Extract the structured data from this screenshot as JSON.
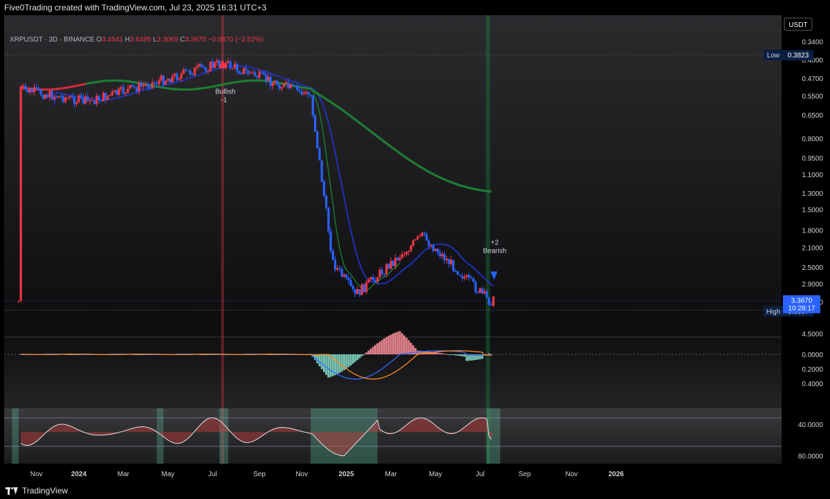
{
  "header": {
    "caption": "Five0Trading created with TradingView.com, Jul 23, 2025 16:31 UTC+3"
  },
  "legend": {
    "symbol": "XRPUSDT · 3D · BINANCE",
    "o_label": "O",
    "o": "3.4541",
    "h_label": "H",
    "h": "3.6495",
    "l_label": "L",
    "l": "3.3069",
    "c_label": "C",
    "c": "3.3670",
    "change": "−0.0870 (−2.52%)"
  },
  "footer": {
    "brand": "TradingView"
  },
  "colors": {
    "up": "#f23645",
    "down": "#2962ff",
    "green_ma": "#1e7d32",
    "blue_ma": "#1f32c8",
    "price_tag": "#2962ff"
  },
  "chart_data": [
    {
      "type": "candlestick",
      "pane": "price",
      "scale": "inverted-log",
      "currency_label": "USDT",
      "y_ticks": [
        "0.3400",
        "0.4000",
        "0.4700",
        "0.5500",
        "0.6500",
        "0.8000",
        "0.9500",
        "1.1000",
        "1.3000",
        "1.5000",
        "1.8000",
        "2.1000",
        "2.5000",
        "2.9000",
        "3.4000",
        "4.5000"
      ],
      "x_ticks": [
        "Nov",
        "2024",
        "Mar",
        "May",
        "Jul",
        "Sep",
        "Nov",
        "2025",
        "Mar",
        "May",
        "Jul",
        "Sep",
        "Nov",
        "2026"
      ],
      "tags": {
        "low_label": "Low",
        "low_value": "0.3823",
        "high_label": "High",
        "high_value": "3.6607",
        "last_value": "3.3670",
        "countdown": "10:28:17"
      },
      "annotations": [
        {
          "text": "Bullish",
          "sub": "-1",
          "date": "Jul 2024"
        },
        {
          "text": "+2",
          "sub": "Bearish",
          "date": "Jul 2025"
        }
      ],
      "key_points": [
        {
          "date": "Oct 2023",
          "price": 0.52
        },
        {
          "date": "Jan 2024",
          "price": 0.58
        },
        {
          "date": "Jul 2024",
          "price": 0.41
        },
        {
          "date": "Nov 2024",
          "price": 0.55
        },
        {
          "date": "Dec 2024",
          "price": 2.4
        },
        {
          "date": "Jan 2025",
          "price": 3.2
        },
        {
          "date": "Apr 2025",
          "price": 1.9
        },
        {
          "date": "Jul 2025",
          "price": 3.37
        }
      ]
    },
    {
      "type": "histogram+line",
      "pane": "macd",
      "scale": "inverted",
      "y_ticks": [
        "0.0000",
        "0.2000",
        "0.4000"
      ]
    },
    {
      "type": "area",
      "pane": "oscillator",
      "scale": "inverted",
      "y_ticks": [
        "40.0000",
        "80.0000"
      ]
    }
  ]
}
